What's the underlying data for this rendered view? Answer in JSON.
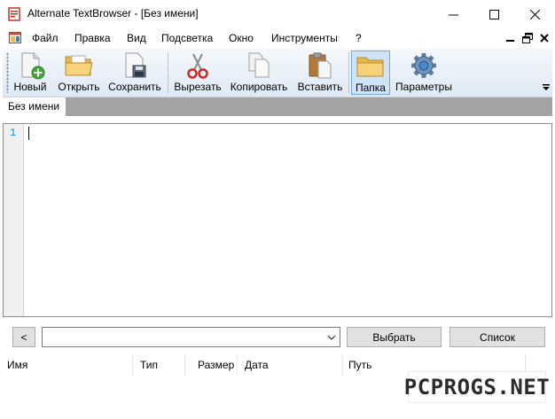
{
  "window": {
    "title": "Alternate TextBrowser - [Без имени]",
    "controls": [
      "minimize",
      "maximize",
      "close"
    ]
  },
  "menu": {
    "items": [
      {
        "label": "Файл"
      },
      {
        "label": "Правка"
      },
      {
        "label": "Вид"
      },
      {
        "label": "Подсветка"
      },
      {
        "label": "Окно"
      },
      {
        "label": "Инструменты"
      },
      {
        "label": "?"
      }
    ]
  },
  "toolbar": {
    "buttons": [
      {
        "label": "Новый",
        "icon": "new-file-icon"
      },
      {
        "label": "Открыть",
        "icon": "open-folder-icon"
      },
      {
        "label": "Сохранить",
        "icon": "save-icon"
      },
      {
        "label": "Вырезать",
        "icon": "cut-icon"
      },
      {
        "label": "Копировать",
        "icon": "copy-icon"
      },
      {
        "label": "Вставить",
        "icon": "paste-icon"
      },
      {
        "label": "Папка",
        "icon": "folder-icon",
        "active": true
      },
      {
        "label": "Параметры",
        "icon": "gear-icon"
      }
    ]
  },
  "tabs": [
    {
      "label": "Без имени",
      "active": true
    }
  ],
  "editor": {
    "line_numbers": [
      "1"
    ],
    "content": ""
  },
  "browser": {
    "back_label": "<",
    "path_value": "",
    "select_label": "Выбрать",
    "list_label": "Список",
    "columns": [
      "Имя",
      "Тип",
      "Размер",
      "Дата",
      "Путь"
    ]
  },
  "watermark": {
    "text": "PCPROGS.NET"
  },
  "colors": {
    "toolbar_top": "#f4f8fc",
    "toolbar_bottom": "#dfe9f5",
    "tab_strip": "#a3a3a3",
    "line_number": "#1e8bd0",
    "button_face": "#e1e1e1"
  }
}
